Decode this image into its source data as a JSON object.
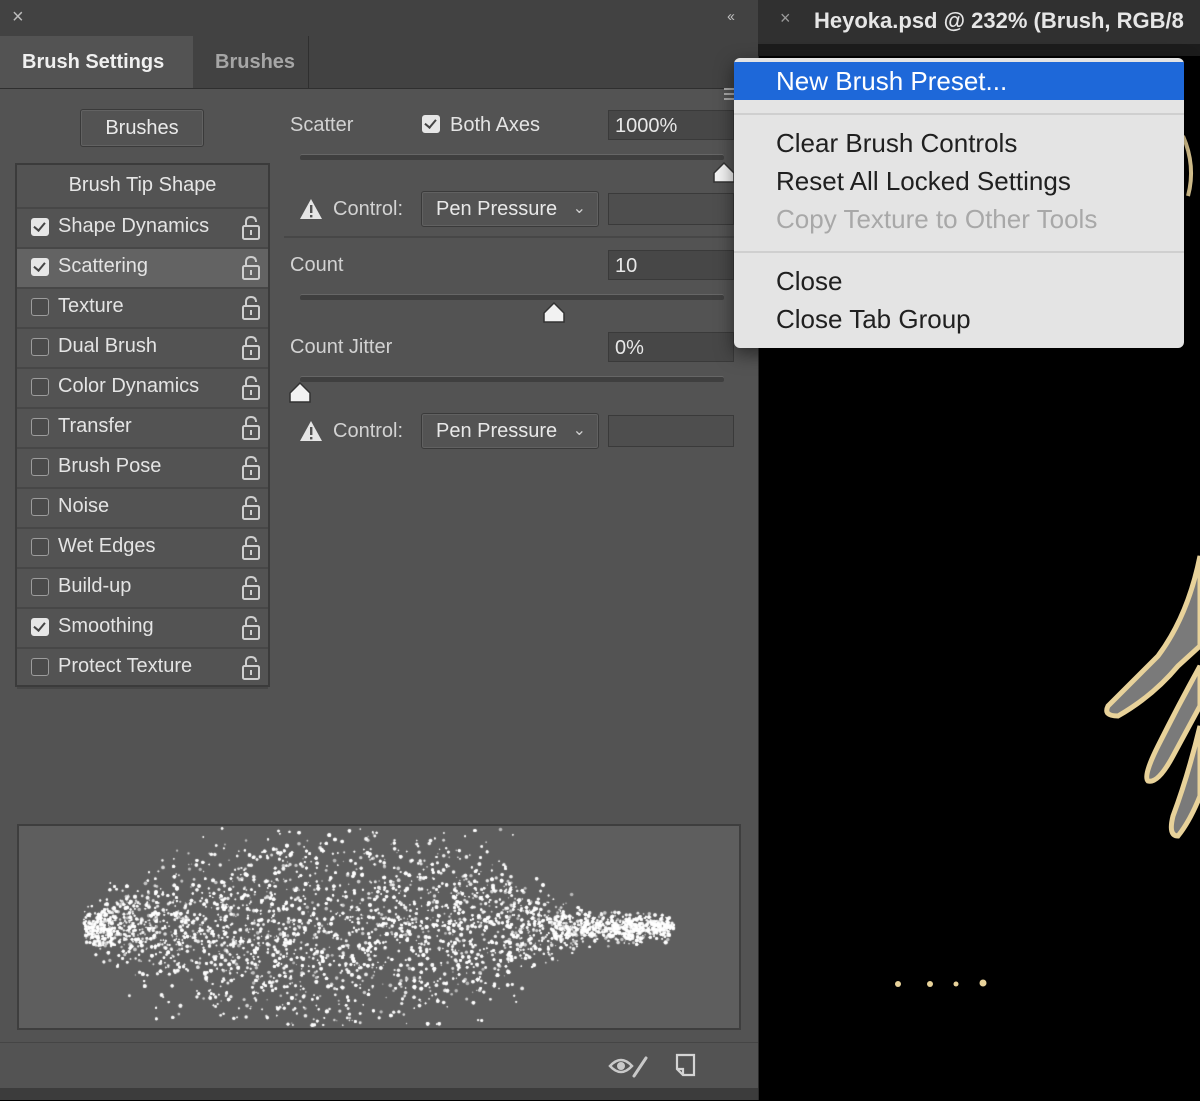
{
  "panel": {
    "close_glyph": "×",
    "collapse_glyph": "«",
    "tabs": [
      {
        "label": "Brush Settings"
      },
      {
        "label": "Brushes"
      }
    ],
    "brushes_button": "Brushes",
    "option_header": "Brush Tip Shape",
    "options": [
      {
        "label": "Shape Dynamics",
        "checked": true
      },
      {
        "label": "Scattering",
        "checked": true,
        "selected": true
      },
      {
        "label": "Texture",
        "checked": false
      },
      {
        "label": "Dual Brush",
        "checked": false
      },
      {
        "label": "Color Dynamics",
        "checked": false
      },
      {
        "label": "Transfer",
        "checked": false
      },
      {
        "label": "Brush Pose",
        "checked": false
      },
      {
        "label": "Noise",
        "checked": false
      },
      {
        "label": "Wet Edges",
        "checked": false
      },
      {
        "label": "Build-up",
        "checked": false
      },
      {
        "label": "Smoothing",
        "checked": true
      },
      {
        "label": "Protect Texture",
        "checked": false
      }
    ],
    "scatter": {
      "label": "Scatter",
      "both_axes_label": "Both Axes",
      "both_axes_checked": true,
      "value": "1000%",
      "slider_fraction": 1.0,
      "control_label": "Control:",
      "control_value": "Pen Pressure"
    },
    "count": {
      "label": "Count",
      "value": "10",
      "slider_fraction": 0.6
    },
    "count_jitter": {
      "label": "Count Jitter",
      "value": "0%",
      "slider_fraction": 0.0,
      "control_label": "Control:",
      "control_value": "Pen Pressure"
    }
  },
  "document": {
    "close_glyph": "×",
    "title": "Heyoka.psd @ 232% (Brush, RGB/8"
  },
  "menu": {
    "items": [
      {
        "label": "New Brush Preset...",
        "highlighted": true
      },
      {
        "label": "Clear Brush Controls"
      },
      {
        "label": "Reset All Locked Settings"
      },
      {
        "label": "Copy Texture to Other Tools",
        "disabled": true
      },
      {
        "label": "Close"
      },
      {
        "label": "Close Tab Group"
      }
    ]
  },
  "colors": {
    "panel_bg": "#535353",
    "panel_dark": "#424242",
    "menu_highlight": "#1e68d9",
    "canvas_bg": "#000000",
    "artwork_outline": "#e8d29a"
  },
  "icons": [
    "warning-icon",
    "lock-icon",
    "eye-brush-icon",
    "new-preset-icon",
    "panel-menu-icon"
  ]
}
